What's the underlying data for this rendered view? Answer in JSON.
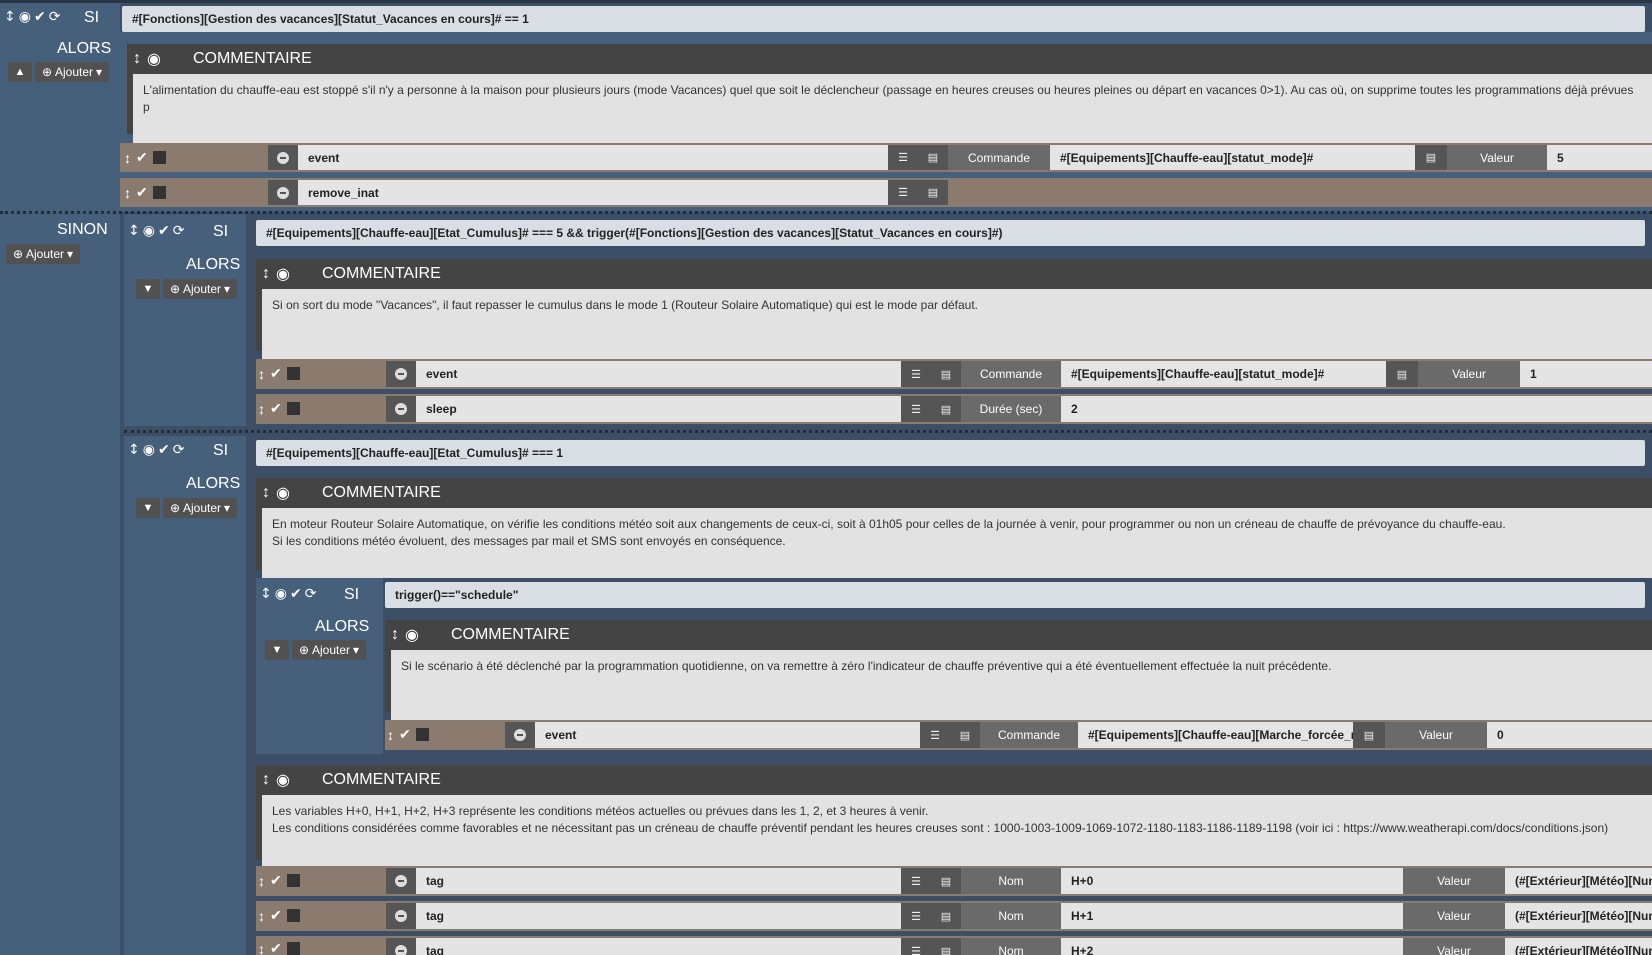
{
  "keywords": {
    "si": "SI",
    "alors": "ALORS",
    "sinon": "SINON",
    "commentaire": "COMMENTAIRE"
  },
  "buttons": {
    "ajouter": "Ajouter"
  },
  "labels": {
    "commande": "Commande",
    "valeur": "Valeur",
    "duree": "Durée (sec)",
    "nom": "Nom"
  },
  "icons": {
    "move": "move-vertical-icon",
    "eye": "eye-icon",
    "check": "check-icon",
    "refresh": "refresh-icon",
    "plus": "plus-circle-icon",
    "caret": "caret-down-icon",
    "minus": "minus-circle-icon",
    "list": "list-icon",
    "edit": "edit-icon"
  },
  "block1": {
    "condition": "#[Fonctions][Gestion des vacances][Statut_Vacances en cours]# == 1",
    "comment": "L'alimentation du chauffe-eau est stoppé s'il n'y a personne à la maison pour plusieurs jours (mode Vacances) quel que soit le déclencheur (passage en heures creuses ou heures pleines ou départ en vacances 0>1). Au cas où, on supprime toutes les programmations déjà prévues p",
    "action1": {
      "cmd": "event",
      "commande": "#[Equipements][Chauffe-eau][statut_mode]#",
      "valeur": "5"
    },
    "action2": {
      "cmd": "remove_inat"
    }
  },
  "block2": {
    "condition": "#[Equipements][Chauffe-eau][Etat_Cumulus]# === 5 && trigger(#[Fonctions][Gestion des vacances][Statut_Vacances en cours]#)",
    "comment": "Si on sort du mode \"Vacances\", il faut repasser le cumulus dans le mode 1 (Routeur Solaire Automatique) qui est le mode par défaut.",
    "action1": {
      "cmd": "event",
      "commande": "#[Equipements][Chauffe-eau][statut_mode]#",
      "valeur": "1"
    },
    "action2": {
      "cmd": "sleep",
      "duree": "2"
    }
  },
  "block3": {
    "condition": "#[Equipements][Chauffe-eau][Etat_Cumulus]# === 1",
    "comment": "En moteur Routeur Solaire Automatique, on vérifie les conditions météo soit aux changements de ceux-ci, soit à 01h05 pour celles de la journée à venir, pour programmer ou non un créneau de chauffe de prévoyance du chauffe-eau.\nSi les conditions météo évoluent, des messages par mail et SMS sont envoyés en conséquence.",
    "inner": {
      "condition": "trigger()==\"schedule\"",
      "comment": "Si le scénario à été déclenché par la programmation quotidienne, on va remettre à zéro l'indicateur de chauffe préventive qui a été éventuellement effectuée la nuit précédente.",
      "action": {
        "cmd": "event",
        "commande": "#[Equipements][Chauffe-eau][Marche_forcée_nuit",
        "valeur": "0"
      }
    },
    "comment2": "Les variables H+0, H+1, H+2, H+3 représente les conditions météos actuelles ou prévues dans les 1, 2, et 3 heures à venir.\nLes conditions considérées comme favorables et ne nécessitant pas un créneau de chauffe préventif pendant les heures creuses sont : 1000-1003-1009-1069-1072-1180-1183-1186-1189-1198 (voir ici : https://www.weatherapi.com/docs/conditions.json)",
    "tags": [
      {
        "cmd": "tag",
        "nom": "H+0",
        "valeur": "(#[Extérieur][Météo][Numéro conditi"
      },
      {
        "cmd": "tag",
        "nom": "H+1",
        "valeur": "(#[Extérieur][Météo][Numéro conditi"
      },
      {
        "cmd": "tag",
        "nom": "H+2",
        "valeur": "(#[Extérieur][Météo][Numéro conditi"
      }
    ]
  }
}
